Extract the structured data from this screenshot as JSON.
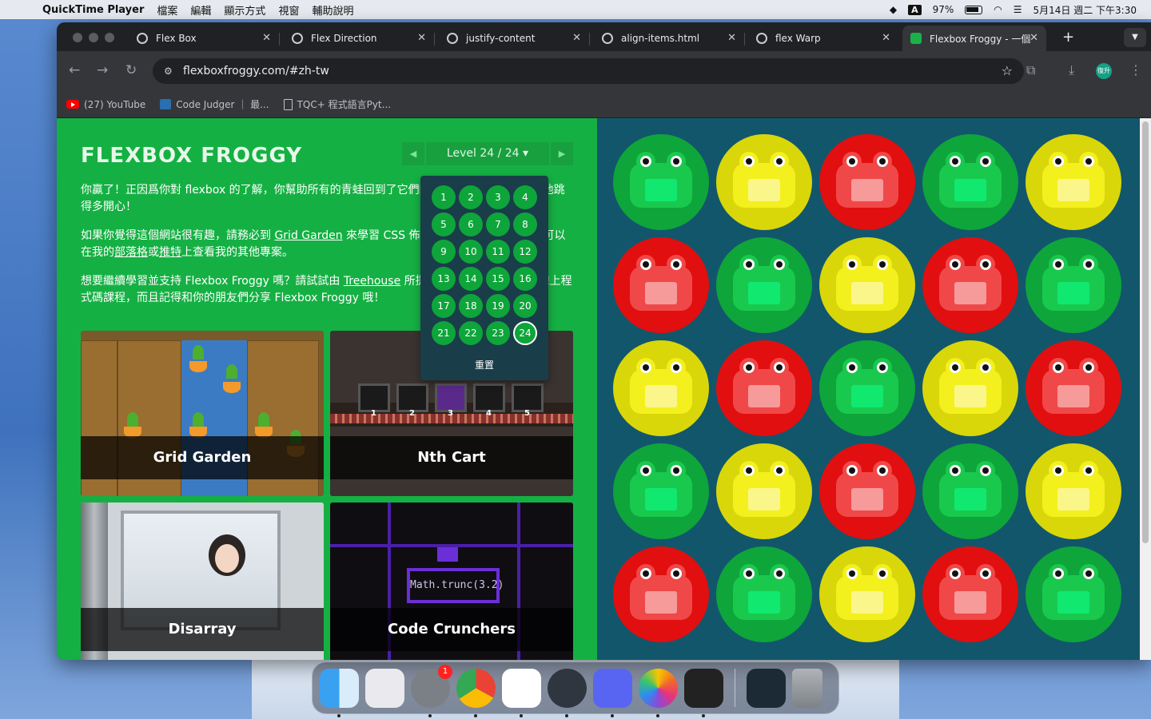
{
  "menubar": {
    "app": "QuickTime Player",
    "items": [
      "檔案",
      "編輯",
      "顯示方式",
      "視窗",
      "輔助說明"
    ],
    "input_method": "A",
    "battery": "97%",
    "datetime": "5月14日 週二 下午3:30"
  },
  "tabs": [
    {
      "title": "Flex Box",
      "active": false
    },
    {
      "title": "Flex Direction",
      "active": false
    },
    {
      "title": "justify-content",
      "active": false
    },
    {
      "title": "align-items.html",
      "active": false
    },
    {
      "title": "flex Warp",
      "active": false
    },
    {
      "title": "Flexbox Froggy - 一個",
      "active": true
    }
  ],
  "address": {
    "url": "flexboxfroggy.com/#zh-tw"
  },
  "profile": {
    "label": "復升"
  },
  "bookmarks": [
    {
      "label": "(27) YouTube",
      "icon": "youtube-icon"
    },
    {
      "label": "Code Judger ｜ 最...",
      "icon": "code-judger-icon"
    },
    {
      "label": "TQC+ 程式語言Pyt...",
      "icon": "document-icon"
    }
  ],
  "game": {
    "logo": "FLEXBOX FROGGY",
    "level_label": "Level 24 / 24",
    "level_prev": "◀",
    "level_next": "▶",
    "intro": {
      "p1": "你贏了！正因爲你對 flexbox 的了解，你幫助所有的青蛙回到了它們的荷葉上。看看牠們多麼地跳得多開心！",
      "p2_a": "如果你覺得這個網站很有趣，請務必到 ",
      "p2_link1": "Grid Garden",
      "p2_b": " 來學習 CSS 佈局中另一個新功能。你也可以在我的",
      "p2_link2": "部落格",
      "p2_c": "或",
      "p2_link3": "推特",
      "p2_d": "上查看我的其他專案。",
      "p3_a": "想要繼續學習並支持 Flexbox Froggy 嗎？請試試由 ",
      "p3_link": "Treehouse",
      "p3_b": " 所提供的網頁設計和開發的線上程式碼課程，而且記得和你的朋友們分享 Flexbox Froggy 哦！"
    },
    "cards": [
      {
        "title": "Grid Garden"
      },
      {
        "title": "Nth Cart",
        "cart_numbers": [
          "1",
          "2",
          "3",
          "4",
          "5"
        ]
      },
      {
        "title": "Disarray"
      },
      {
        "title": "Code Crunchers",
        "code": "Math.trunc(3.2)"
      }
    ],
    "levels": [
      "1",
      "2",
      "3",
      "4",
      "5",
      "6",
      "7",
      "8",
      "9",
      "10",
      "11",
      "12",
      "13",
      "14",
      "15",
      "16",
      "17",
      "18",
      "19",
      "20",
      "21",
      "22",
      "23",
      "24"
    ],
    "current_level": "24",
    "reset_label": "重置",
    "pond_grid": [
      [
        "green",
        "yellow",
        "red",
        "green",
        "yellow"
      ],
      [
        "red",
        "green",
        "yellow",
        "red",
        "green"
      ],
      [
        "yellow",
        "red",
        "green",
        "yellow",
        "red"
      ],
      [
        "green",
        "yellow",
        "red",
        "green",
        "yellow"
      ],
      [
        "red",
        "green",
        "yellow",
        "red",
        "green"
      ]
    ]
  },
  "colors": {
    "left_panel": "#15b043",
    "pond": "#12566c",
    "green": "#0ea53a",
    "yellow": "#d9d70a",
    "red": "#e10f0f"
  },
  "dock": {
    "apps": [
      "finder-icon",
      "launchpad-icon",
      "system-settings-icon",
      "chrome-icon",
      "vscode-icon",
      "electron-icon",
      "discord-icon",
      "photos-icon",
      "quicktime-icon"
    ],
    "settings_badge": "1"
  }
}
